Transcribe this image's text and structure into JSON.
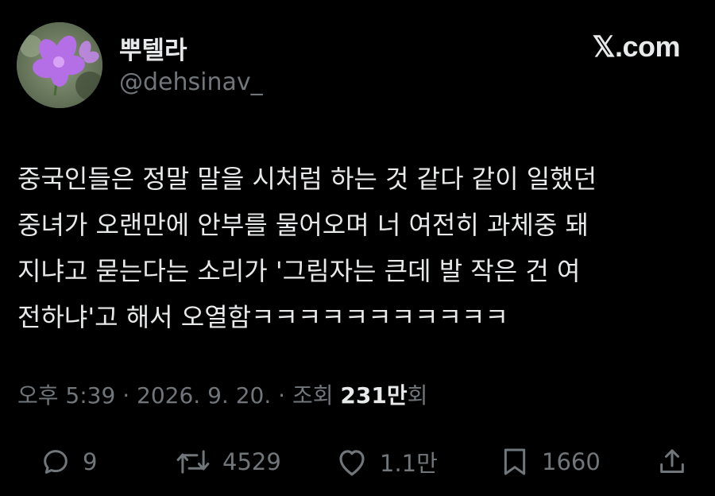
{
  "user": {
    "display_name": "뿌텔라",
    "handle": "@dehsinav_",
    "avatar_icon": "purple-flower-avatar"
  },
  "brand": "𝕏.com",
  "tweet": {
    "text": "중국인들은 정말 말을 시처럼 하는 것 같다 같이 일했던\n중녀가 오랜만에 안부를 물어오며 너 여전히 과체중 돼\n지냐고 묻는다는 소리가 '그림자는 큰데 발 작은 건 여\n전하냐'고 해서 오열함ㅋㅋㅋㅋㅋㅋㅋㅋㅋㅋㅋ"
  },
  "meta": {
    "time": "오후 5:39",
    "date": "2026. 9. 20.",
    "views_label": "조회",
    "views_count": "231만",
    "views_suffix": "회",
    "separator": "·"
  },
  "actions": {
    "replies": "9",
    "reposts": "4529",
    "likes": "1.1만",
    "bookmarks": "1660"
  },
  "colors": {
    "background": "#000000",
    "text_primary": "#e7e9ea",
    "text_secondary": "#71767b"
  }
}
